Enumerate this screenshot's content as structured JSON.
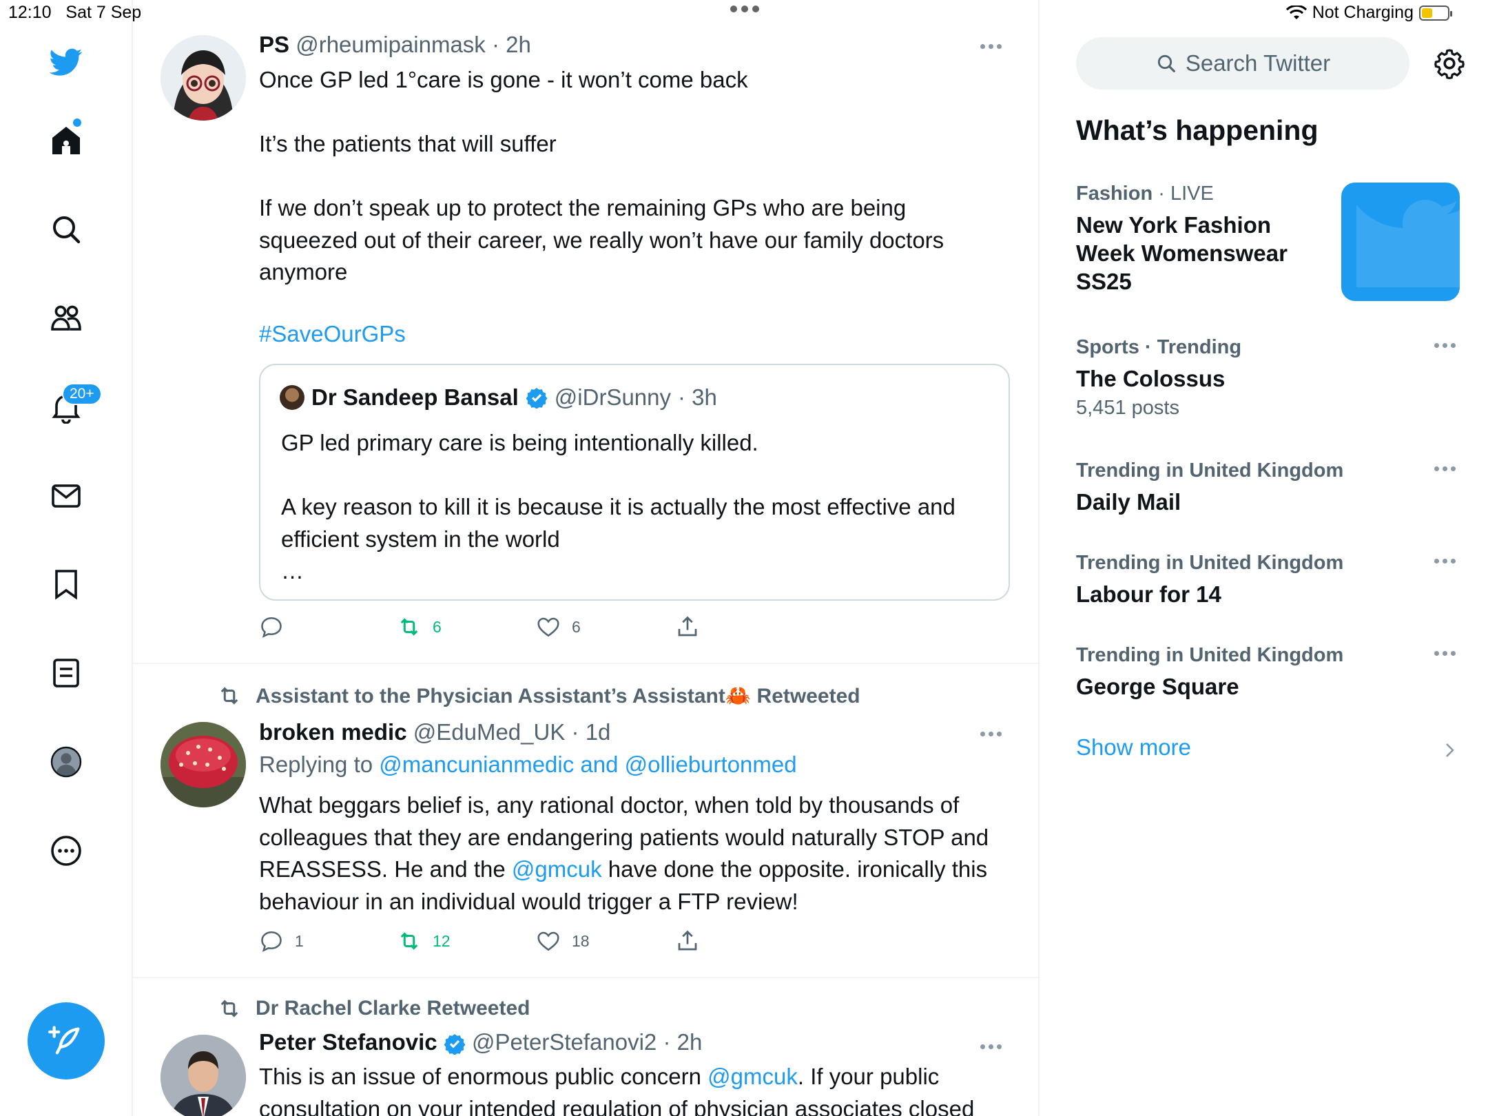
{
  "status_bar": {
    "time": "12:10",
    "date": "Sat 7 Sep",
    "charging": "Not Charging"
  },
  "nav": {
    "notifications_badge": "20+"
  },
  "tweets": [
    {
      "name": "PS",
      "handle": "@rheumipainmask",
      "time": "· 2h",
      "lines": [
        "Once GP led 1°care is gone - it won’t come back",
        "It’s the patients that will suffer",
        "If we don’t speak up to protect the remaining GPs who are being squeezed out of their career, we really won’t have our family doctors anymore"
      ],
      "hashtag": "#SaveOurGPs",
      "quote": {
        "name": "Dr Sandeep Bansal",
        "handle": "@iDrSunny",
        "time": "· 3h",
        "line1": "GP led primary care is being intentionally killed.",
        "line2": "A key reason to kill it is because it is actually the most effective and efficient system in the world",
        "ellipsis": "…"
      },
      "counts": {
        "replies": "",
        "retweets": "6",
        "likes": "6"
      }
    },
    {
      "retweeted_by": "Assistant to the Physician Assistant’s Assistant🦀 Retweeted",
      "name": "broken medic",
      "handle": "@EduMed_UK",
      "time": "· 1d",
      "replying_prefix": "Replying to ",
      "replying_to": "@mancunianmedic and @ollieburtonmed",
      "body_part1": "What beggars belief is, any rational doctor, when told by thousands of colleagues that they are endangering patients would naturally STOP and REASSESS. He and the ",
      "body_mention": "@gmcuk",
      "body_part2": " have done the opposite. ironically this behaviour in an individual would trigger a FTP review!",
      "counts": {
        "replies": "1",
        "retweets": "12",
        "likes": "18"
      }
    },
    {
      "retweeted_by": "Dr Rachel Clarke Retweeted",
      "name": "Peter Stefanovic",
      "handle": "@PeterStefanovi2",
      "time": "· 2h",
      "body_part1": "This is an issue of enormous public concern ",
      "body_mention": "@gmcuk",
      "body_part2": ". If your public consultation on your intended regulation of physician associates closed"
    }
  ],
  "sidebar": {
    "search_placeholder": "Search Twitter",
    "heading": "What’s happening",
    "trends": [
      {
        "category": "Fashion",
        "status": "· LIVE",
        "title": "New York Fashion Week Womenswear SS25"
      },
      {
        "category": "Sports · Trending",
        "title": "The Colossus",
        "posts": "5,451 posts"
      },
      {
        "category": "Trending in United Kingdom",
        "title": "Daily Mail"
      },
      {
        "category": "Trending in United Kingdom",
        "title": "Labour for 14"
      },
      {
        "category": "Trending in United Kingdom",
        "title": "George Square"
      }
    ],
    "show_more": "Show more"
  },
  "colors": {
    "accent": "#1d9bf0",
    "retweet": "#00ba7c",
    "muted": "#536471"
  }
}
